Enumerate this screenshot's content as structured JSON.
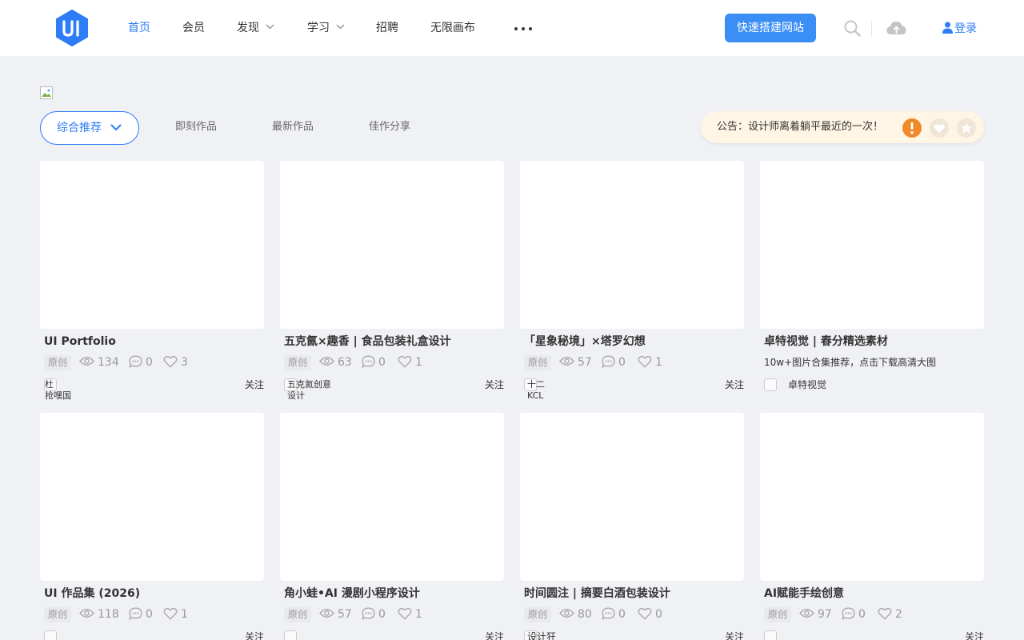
{
  "nav": {
    "items": [
      {
        "label": "首页",
        "active": true
      },
      {
        "label": "会员"
      },
      {
        "label": "发现",
        "dropdown": true
      },
      {
        "label": "学习",
        "dropdown": true
      },
      {
        "label": "招聘"
      },
      {
        "label": "无限画布"
      }
    ],
    "build_button": "快速搭建网站",
    "login": "登录",
    "icons": [
      "logo-icon",
      "more-dots-icon",
      "search-icon",
      "cloud-upload-icon",
      "user-icon"
    ]
  },
  "filter": {
    "sort_label": "综合推荐",
    "tabs": [
      "即刻作品",
      "最新作品",
      "佳作分享"
    ]
  },
  "notice": {
    "text": "公告：设计师离着躺平最近的一次！",
    "icons": [
      "alert-icon",
      "heart-icon",
      "star-icon"
    ]
  },
  "colors": {
    "accent": "#2e7cf6",
    "button": "#3b8ef5",
    "notice_bg": "#fff5e4",
    "alert": "#f0892a",
    "page_bg": "#f0f1f5"
  },
  "cards": [
    {
      "title": "UI Portfolio",
      "badge": "原创",
      "views": "134",
      "comments": "0",
      "likes": "3",
      "author": "杜\n抢嘿国",
      "follow": "关注"
    },
    {
      "title": "五克氤×趣香 | 食品包装礼盒设计",
      "badge": "原创",
      "views": "63",
      "comments": "0",
      "likes": "1",
      "author": "五克氮创意\n设计",
      "follow": "关注"
    },
    {
      "title": "「星象秘境」×塔罗幻想",
      "badge": "原创",
      "views": "57",
      "comments": "0",
      "likes": "1",
      "author": "十二\nKCL",
      "follow": "关注"
    },
    {
      "title": "卓特视觉 | 春分精选素材",
      "desc": "10w+图片合集推荐，点击下载高清大图",
      "author": "卓特视觉"
    },
    {
      "title": "UI 作品集 (2026)",
      "badge": "原创",
      "views": "118",
      "comments": "0",
      "likes": "1",
      "author": "",
      "follow": "关注"
    },
    {
      "title": "角小蛙•AI 漫剧小程序设计",
      "badge": "原创",
      "views": "57",
      "comments": "0",
      "likes": "1",
      "author": "",
      "follow": "关注"
    },
    {
      "title": "时间圆注 | 摘要白酒包装设计",
      "badge": "原创",
      "views": "80",
      "comments": "0",
      "likes": "0",
      "author": "设计狂",
      "follow": "关注"
    },
    {
      "title": "AI赋能手绘创意",
      "badge": "原创",
      "views": "97",
      "comments": "0",
      "likes": "2",
      "author": "",
      "follow": "关注"
    }
  ]
}
